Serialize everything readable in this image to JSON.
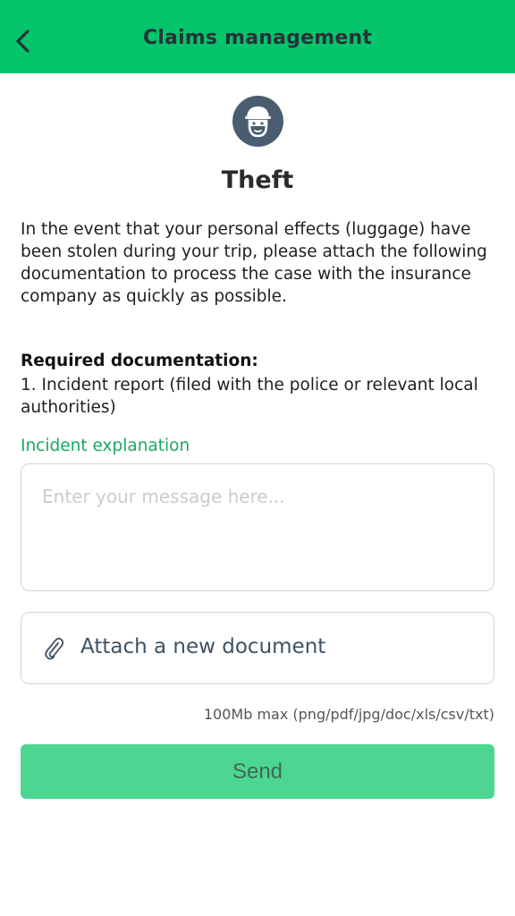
{
  "header": {
    "title": "Claims management",
    "back_icon": "chevron-left-icon",
    "background": "#05c46b"
  },
  "claim": {
    "icon": "thief-icon",
    "title": "Theft",
    "description": "In the event that your personal effects (luggage) have been stolen during your trip, please attach the following documentation to process the case with the insurance company as quickly as possible."
  },
  "requirements": {
    "title": "Required documentation:",
    "items": [
      "1. Incident report (filed with the police or relevant local authorities)"
    ]
  },
  "form": {
    "explanation_label": "Incident explanation",
    "explanation_placeholder": "Enter your message here...",
    "explanation_value": "",
    "attach_icon": "paperclip-icon",
    "attach_label": "Attach a new document",
    "limit_note": "100Mb max (png/pdf/jpg/doc/xls/csv/txt)",
    "send_label": "Send",
    "accent_color": "#1aa864",
    "send_color": "#4dd691"
  }
}
